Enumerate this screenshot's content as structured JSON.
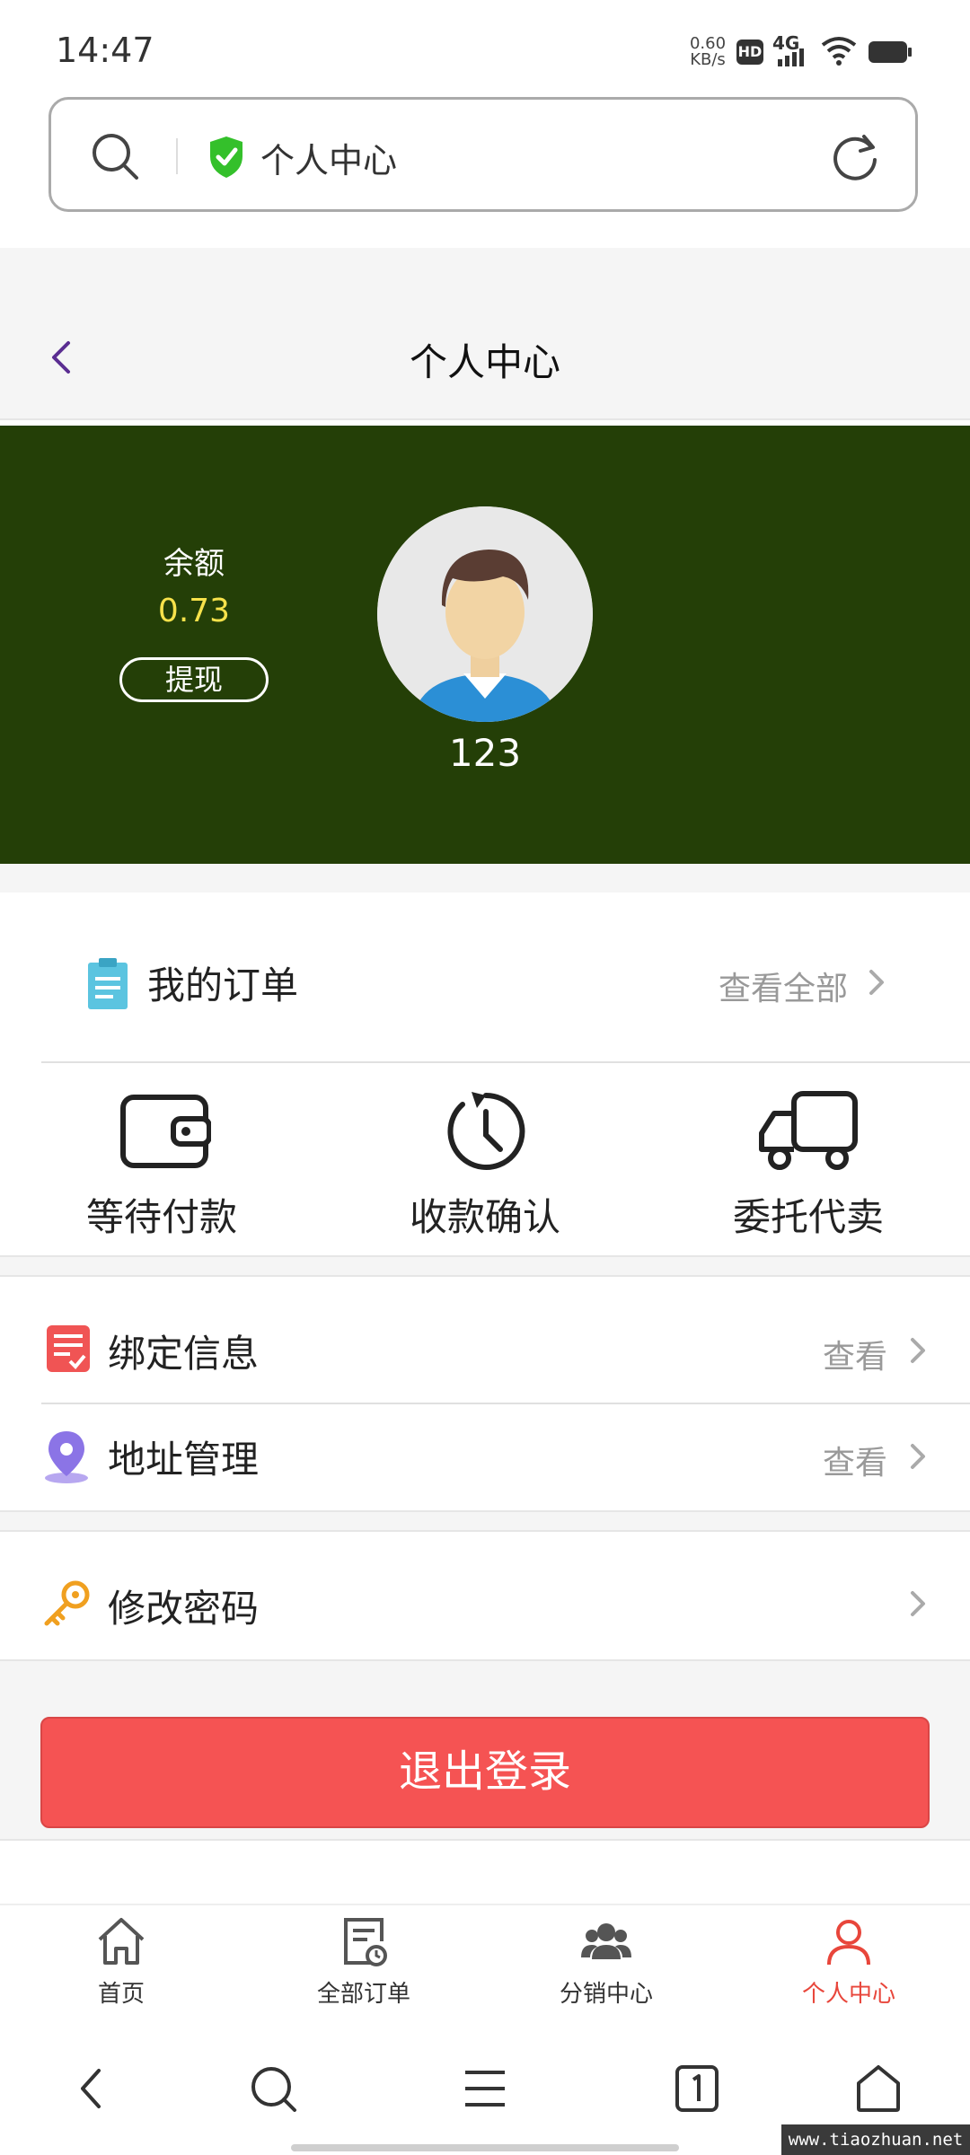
{
  "status_bar": {
    "time": "14:47",
    "net_speed_value": "0.60",
    "net_speed_unit": "KB/s",
    "hd_badge": "HD",
    "network": "4G"
  },
  "browser": {
    "address_title": "个人中心"
  },
  "nav": {
    "title": "个人中心"
  },
  "profile": {
    "balance_label": "余额",
    "balance_value": "0.73",
    "withdraw_label": "提现",
    "username": "123",
    "banner_color": "#243f07",
    "balance_color": "#f7e24b"
  },
  "orders": {
    "title": "我的订单",
    "view_all": "查看全部",
    "items": [
      {
        "label": "等待付款",
        "icon": "wallet-icon"
      },
      {
        "label": "收款确认",
        "icon": "clock-icon"
      },
      {
        "label": "委托代卖",
        "icon": "truck-icon"
      }
    ]
  },
  "menu": {
    "binding_info": {
      "label": "绑定信息",
      "action": "查看",
      "icon": "checklist-icon"
    },
    "address": {
      "label": "地址管理",
      "action": "查看",
      "icon": "location-pin-icon"
    },
    "password": {
      "label": "修改密码",
      "icon": "key-icon"
    }
  },
  "logout": {
    "label": "退出登录",
    "color": "#f55353"
  },
  "tabbar": {
    "items": [
      {
        "label": "首页",
        "icon": "home-icon"
      },
      {
        "label": "全部订单",
        "icon": "orders-icon"
      },
      {
        "label": "分销中心",
        "icon": "group-icon"
      },
      {
        "label": "个人中心",
        "icon": "user-icon",
        "active": true
      }
    ],
    "active_color": "#e8463b"
  },
  "watermark": "www.tiaozhuan.net"
}
